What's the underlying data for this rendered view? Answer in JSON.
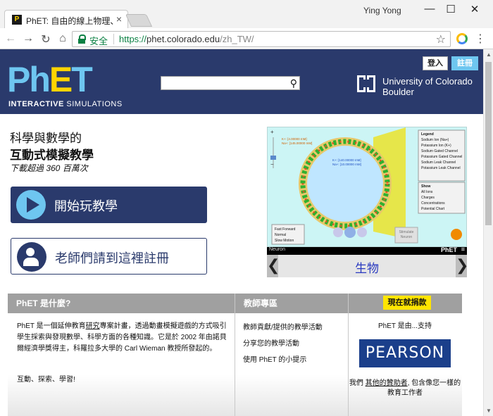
{
  "browser": {
    "tab_title": "PhET: 自由的線上物理、化",
    "tab_favicon": "P",
    "tab_close": "×",
    "user_name": "Ying Yong",
    "win_minimize": "—",
    "win_maximize": "☐",
    "win_close": "✕",
    "back": "←",
    "forward": "→",
    "reload": "↻",
    "home": "⌂",
    "secure_label": "安全",
    "url_scheme": "https://",
    "url_host": "phet.colorado.edu",
    "url_path": "/zh_TW/",
    "bookmark": "☆",
    "menu": "⋮"
  },
  "header": {
    "logo_ph": "Ph",
    "logo_e": "E",
    "logo_t": "T",
    "logo_sub_bold": "INTERACTIVE",
    "logo_sub": " SIMULATIONS",
    "search_icon": "⚲",
    "login": "登入",
    "register": "註冊",
    "university_line1": "University of Colorado",
    "university_line2": "Boulder"
  },
  "hero": {
    "line1": "科學與數學的",
    "line2": "互動式模擬教學",
    "downloads": "下載超過 360 百萬次",
    "play_button": "開始玩教學",
    "teacher_button": "老師們請到這裡註冊"
  },
  "simulation": {
    "footer_name": "Neuron",
    "footer_brand": "PhET",
    "footer_menu": "≡",
    "category": "生物",
    "prev": "❮",
    "next": "❯",
    "legend_title": "Legend",
    "legend": [
      "Sodium Ion (Na+)",
      "Potassium Ion (K+)",
      "Sodium Gated Channel",
      "Potassium Gated Channel",
      "Sodium Leak Channel",
      "Potassium Leak Channel"
    ],
    "show_title": "Show",
    "show": [
      "All Ions",
      "Charges",
      "Concentrations",
      "Potential Chart"
    ],
    "speeds": [
      "Fast Forward",
      "Normal",
      "Slow Motion"
    ],
    "stimulate_line1": "Stimulate",
    "stimulate_line2": "Neuron",
    "conc_outside_1": "K+: [4.00000 mM]",
    "conc_outside_2": "Na+: [145.00000 mM]",
    "conc_inside_1": "K+: [140.00000 mM]",
    "conc_inside_2": "Na+: [10.00000 mM]",
    "zoom_in": "+",
    "zoom_out": "−"
  },
  "panels": {
    "about_title": "PhET 是什麼?",
    "about_pre": "PhET 是一個延伸教育",
    "about_link": "研究",
    "about_post": "專案計畫，透過動畫模擬遊戲的方式吸引學生採索與發現數學、科學方面的各種知識。它是於 2002 年由諾貝爾經濟學獎得主，科羅拉多大學的 Carl Wieman 教授所發起的。",
    "about_tagline": "互動、探索、學習!",
    "teachers_title": "教師專區",
    "teacher_links": [
      "教師貢獻/提供的教學活動",
      "分享您的教學活動",
      "使用 PhET 的小提示"
    ],
    "donate": "現在就捐款",
    "support_text": "PhET 是由...支持",
    "sponsor": "PEARSON",
    "thanks_pre": "我們 ",
    "thanks_link": "其他的贊助者",
    "thanks_post": ", 包含像您一樣的教育工作者"
  },
  "colors": {
    "header_bg": "#2a3a6c",
    "phet_blue": "#6ec6f0",
    "phet_yellow": "#ffd400",
    "pearson_blue": "#1b3f8b",
    "donate_yellow": "#ffe500"
  }
}
